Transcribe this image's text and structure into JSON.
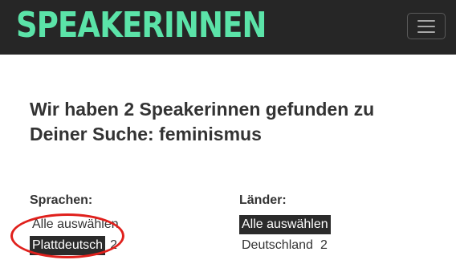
{
  "header": {
    "logo_text": "SPEAKERINNEN",
    "logo_color": "#5be3a8",
    "background": "#262626",
    "menu_icon": "hamburger-menu-icon"
  },
  "results": {
    "prefix": "Wir haben ",
    "count": "2",
    "middle": " Speakerinnen gefunden zu Deiner Suche: ",
    "query": "feminismus"
  },
  "filters": {
    "languages": {
      "title": "Sprachen:",
      "select_all": "Alle auswählen",
      "options": [
        {
          "label": "Plattdeutsch",
          "count": "2",
          "selected": true
        }
      ]
    },
    "countries": {
      "title": "Länder:",
      "select_all": "Alle auswählen",
      "select_all_selected": true,
      "options": [
        {
          "label": "Deutschland",
          "count": "2",
          "selected": false
        }
      ]
    }
  },
  "annotation": {
    "ring_color": "#e0201c"
  }
}
